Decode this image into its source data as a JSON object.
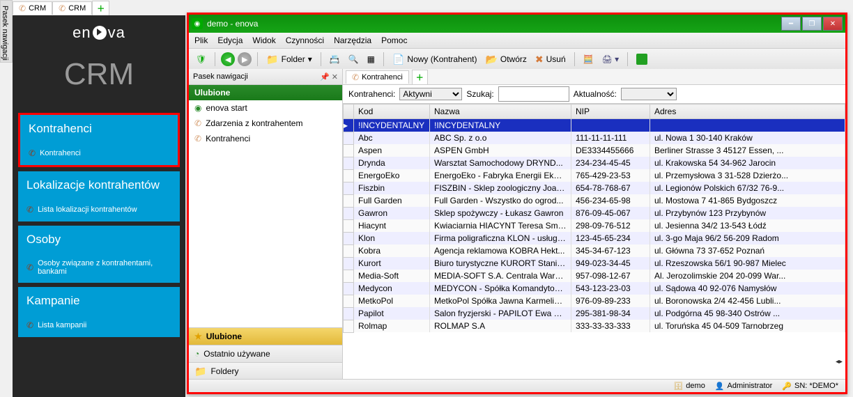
{
  "vertTab": "Pasek nawigacji",
  "topTabs": [
    "CRM",
    "CRM"
  ],
  "brand": "enova",
  "bigTitle": "CRM",
  "tiles": [
    {
      "title": "Kontrahenci",
      "sub": "Kontrahenci",
      "selected": true
    },
    {
      "title": "Lokalizacje kontrahentów",
      "sub": "Lista lokalizacji kontrahentów"
    },
    {
      "title": "Osoby",
      "sub": "Osoby związane z kontrahentami, bankami"
    },
    {
      "title": "Kampanie",
      "sub": "Lista kampanii"
    }
  ],
  "window": {
    "title": "demo - enova",
    "menu": [
      "Plik",
      "Edycja",
      "Widok",
      "Czynności",
      "Narzędzia",
      "Pomoc"
    ],
    "toolbar": {
      "folder": "Folder",
      "newBtn": "Nowy (Kontrahent)",
      "open": "Otwórz",
      "del": "Usuń"
    }
  },
  "navPanel": {
    "header": "Pasek nawigacji",
    "sections": {
      "fav": "Ulubione",
      "recent": "Ostatnio używane",
      "folders": "Foldery"
    },
    "favItems": [
      "enova start",
      "Zdarzenia z kontrahentem",
      "Kontrahenci"
    ]
  },
  "content": {
    "tab": "Kontrahenci",
    "filters": {
      "kontLabel": "Kontrahenci:",
      "kontValue": "Aktywni",
      "szukajLabel": "Szukaj:",
      "aktLabel": "Aktualność:"
    },
    "columns": [
      "Kod",
      "Nazwa",
      "NIP",
      "Adres"
    ],
    "rows": [
      {
        "kod": "!INCYDENTALNY",
        "nazwa": "!INCYDENTALNY",
        "nip": "",
        "adres": "",
        "sel": true
      },
      {
        "kod": "Abc",
        "nazwa": "ABC Sp. z o.o",
        "nip": "111-11-11-111",
        "adres": "ul. Nowa 1 30-140 Kraków"
      },
      {
        "kod": "Aspen",
        "nazwa": "ASPEN GmbH",
        "nip": "DE3334455666",
        "adres": "Berliner Strasse 3  45127 Essen, ..."
      },
      {
        "kod": "Drynda",
        "nazwa": "Warsztat Samochodowy DRYND...",
        "nip": "234-234-45-45",
        "adres": "ul. Krakowska 54 34-962 Jarocin"
      },
      {
        "kod": "EnergoEko",
        "nazwa": "EnergoEko - Fabryka Energii Ekol...",
        "nip": "765-429-23-53",
        "adres": "ul. Przemysłowa 3 31-528 Dzierżo..."
      },
      {
        "kod": "Fiszbin",
        "nazwa": "FISZBIN - Sklep zoologiczny Joan...",
        "nip": "654-78-768-67",
        "adres": "ul. Legionów Polskich 67/32 76-9..."
      },
      {
        "kod": "Full Garden",
        "nazwa": "Full Garden - Wszystko do ogrod...",
        "nip": "456-234-65-98",
        "adres": "ul. Mostowa 7 41-865 Bydgoszcz"
      },
      {
        "kod": "Gawron",
        "nazwa": "Sklep spożywczy - Łukasz Gawron",
        "nip": "876-09-45-067",
        "adres": "ul. Przybynów 123  Przybynów"
      },
      {
        "kod": "Hiacynt",
        "nazwa": "Kwiaciarnia HIACYNT Teresa Smu...",
        "nip": "298-09-76-512",
        "adres": "ul. Jesienna 34/2 13-543 Łódź"
      },
      {
        "kod": "Klon",
        "nazwa": "Firma poligraficzna KLON - usługi ...",
        "nip": "123-45-65-234",
        "adres": "ul. 3-go Maja 96/2 56-209 Radom"
      },
      {
        "kod": "Kobra",
        "nazwa": "Agencja reklamowa KOBRA Hekt...",
        "nip": "345-34-67-123",
        "adres": "ul. Główna 73 37-652 Poznań"
      },
      {
        "kod": "Kurort",
        "nazwa": "Biuro turystyczne KURORT Stanisł...",
        "nip": "949-023-34-45",
        "adres": "ul. Rzeszowska 56/1 90-987 Mielec"
      },
      {
        "kod": "Media-Soft",
        "nazwa": "MEDIA-SOFT S.A. Centrala Warsz...",
        "nip": "957-098-12-67",
        "adres": "Al. Jerozolimskie 204 20-099 War..."
      },
      {
        "kod": "Medycon",
        "nazwa": "MEDYCON - Spółka Komandytow...",
        "nip": "543-123-23-03",
        "adres": "ul. Sądowa 40 92-076 Namysłów"
      },
      {
        "kod": "MetkoPol",
        "nazwa": "MetkoPol Spółka Jawna Karmelick...",
        "nip": "976-09-89-233",
        "adres": "ul. Boronowska 2/4 42-456 Lubli..."
      },
      {
        "kod": "Papilot",
        "nazwa": "Salon fryzjerski - PAPILOT Ewa G...",
        "nip": "295-381-98-34",
        "adres": "ul. Podgórna 45 98-340 Ostrów ..."
      },
      {
        "kod": "Rolmap",
        "nazwa": "ROLMAP S.A",
        "nip": "333-33-33-333",
        "adres": "ul. Toruńska 45 04-509 Tarnobrzeg"
      }
    ]
  },
  "status": {
    "db": "demo",
    "user": "Administrator",
    "sn": "SN: *DEMO*"
  }
}
